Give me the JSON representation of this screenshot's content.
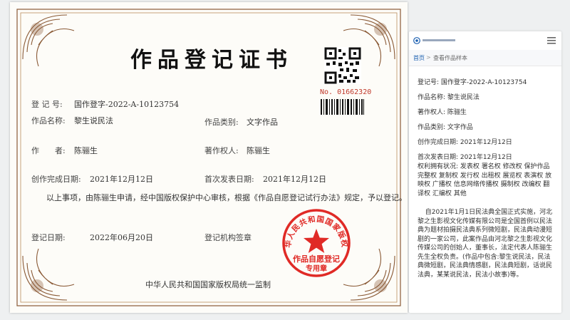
{
  "certificate": {
    "title": "作品登记证书",
    "serial_no": "No. 01662320",
    "reg_no_label": "登 记 号:",
    "reg_no": "国作登字-2022-A-10123754",
    "work_name_label": "作品名称:",
    "work_name": "黎生说民法",
    "category_label": "作品类别:",
    "category": "文字作品",
    "author_label": "作　　者:",
    "author": "陈骊生",
    "owner_label": "著作权人:",
    "owner": "陈骊生",
    "created_label": "创作完成日期:",
    "created": "2021年12月12日",
    "published_label": "首次发表日期:",
    "published": "2021年12月12日",
    "statement": "以上事项，由陈骊生申请，经中国版权保护中心审核，根据《作品自愿登记试行办法》规定，予以登记。",
    "reg_date_label": "登记日期:",
    "reg_date": "2022年06月20日",
    "authority_label": "登记机构签章",
    "footer": "中华人民共和国国家版权局统一监制",
    "seal_ring": "中华人民共和国国家版权局",
    "seal_line1": "作品自愿登记",
    "seal_line2": "专用章"
  },
  "phone": {
    "crumb_home": "首页",
    "crumb_sep": ">",
    "crumb_page": "查看作品样本",
    "rows": [
      {
        "label": "登记号:",
        "value": "国作登字-2022-A-10123754"
      },
      {
        "label": "作品名称:",
        "value": "黎生说民法"
      },
      {
        "label": "著作权人:",
        "value": "陈骊生"
      },
      {
        "label": "作品类别:",
        "value": "文字作品"
      },
      {
        "label": "创作完成日期:",
        "value": "2021年12月12日"
      },
      {
        "label": "首次发表日期:",
        "value": "2021年12月12日"
      }
    ],
    "rights": "权利拥有状况: 发表权 署名权 修改权 保护作品完整权 复制权 发行权 出租权 展览权 表演权 放映权 广播权 信息网络传播权 摄制权 改编权 翻译权 汇编权 其他",
    "description": "自2021年1月1日民法典全国正式实施，河北黎之生影视文化传媒有限公司是全国首例以民法典为题材拍摄民法典系列微短剧，民法典动漫短剧的一家公司，此案作品由河北黎之生影视文化传媒公司的创始人，董事长，法定代表人陈骊生先生全权负责。(作品中包含:黎生说民法，民法典微短剧，民法典情感剧，民法典短剧，话说民法典，某某说民法，民法小故事)等。"
  },
  "colors": {
    "frame_brown": "#8a5a36",
    "seal_red": "#e02a26",
    "link_blue": "#1b5fb0"
  }
}
